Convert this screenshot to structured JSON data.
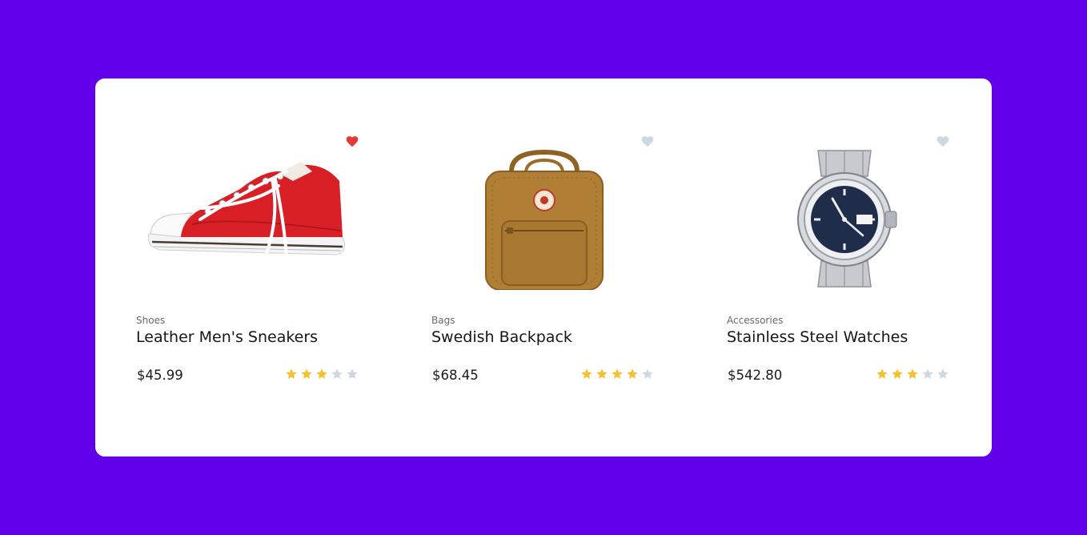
{
  "colors": {
    "background": "#6200ea",
    "card": "#ffffff",
    "star_filled": "#f7c12e",
    "star_empty": "#ced8e0",
    "heart_active": "#e53935",
    "heart_inactive": "#ced8e0"
  },
  "products": [
    {
      "category": "Shoes",
      "title": "Leather Men's Sneakers",
      "price": "$45.99",
      "rating": 3,
      "max_rating": 5,
      "favorited": true,
      "image": "red-canvas-sneaker-image"
    },
    {
      "category": "Bags",
      "title": "Swedish Backpack",
      "price": "$68.45",
      "rating": 4,
      "max_rating": 5,
      "favorited": false,
      "image": "tan-backpack-image"
    },
    {
      "category": "Accessories",
      "title": "Stainless Steel Watches",
      "price": "$542.80",
      "rating": 3,
      "max_rating": 5,
      "favorited": false,
      "image": "steel-wristwatch-image"
    }
  ]
}
